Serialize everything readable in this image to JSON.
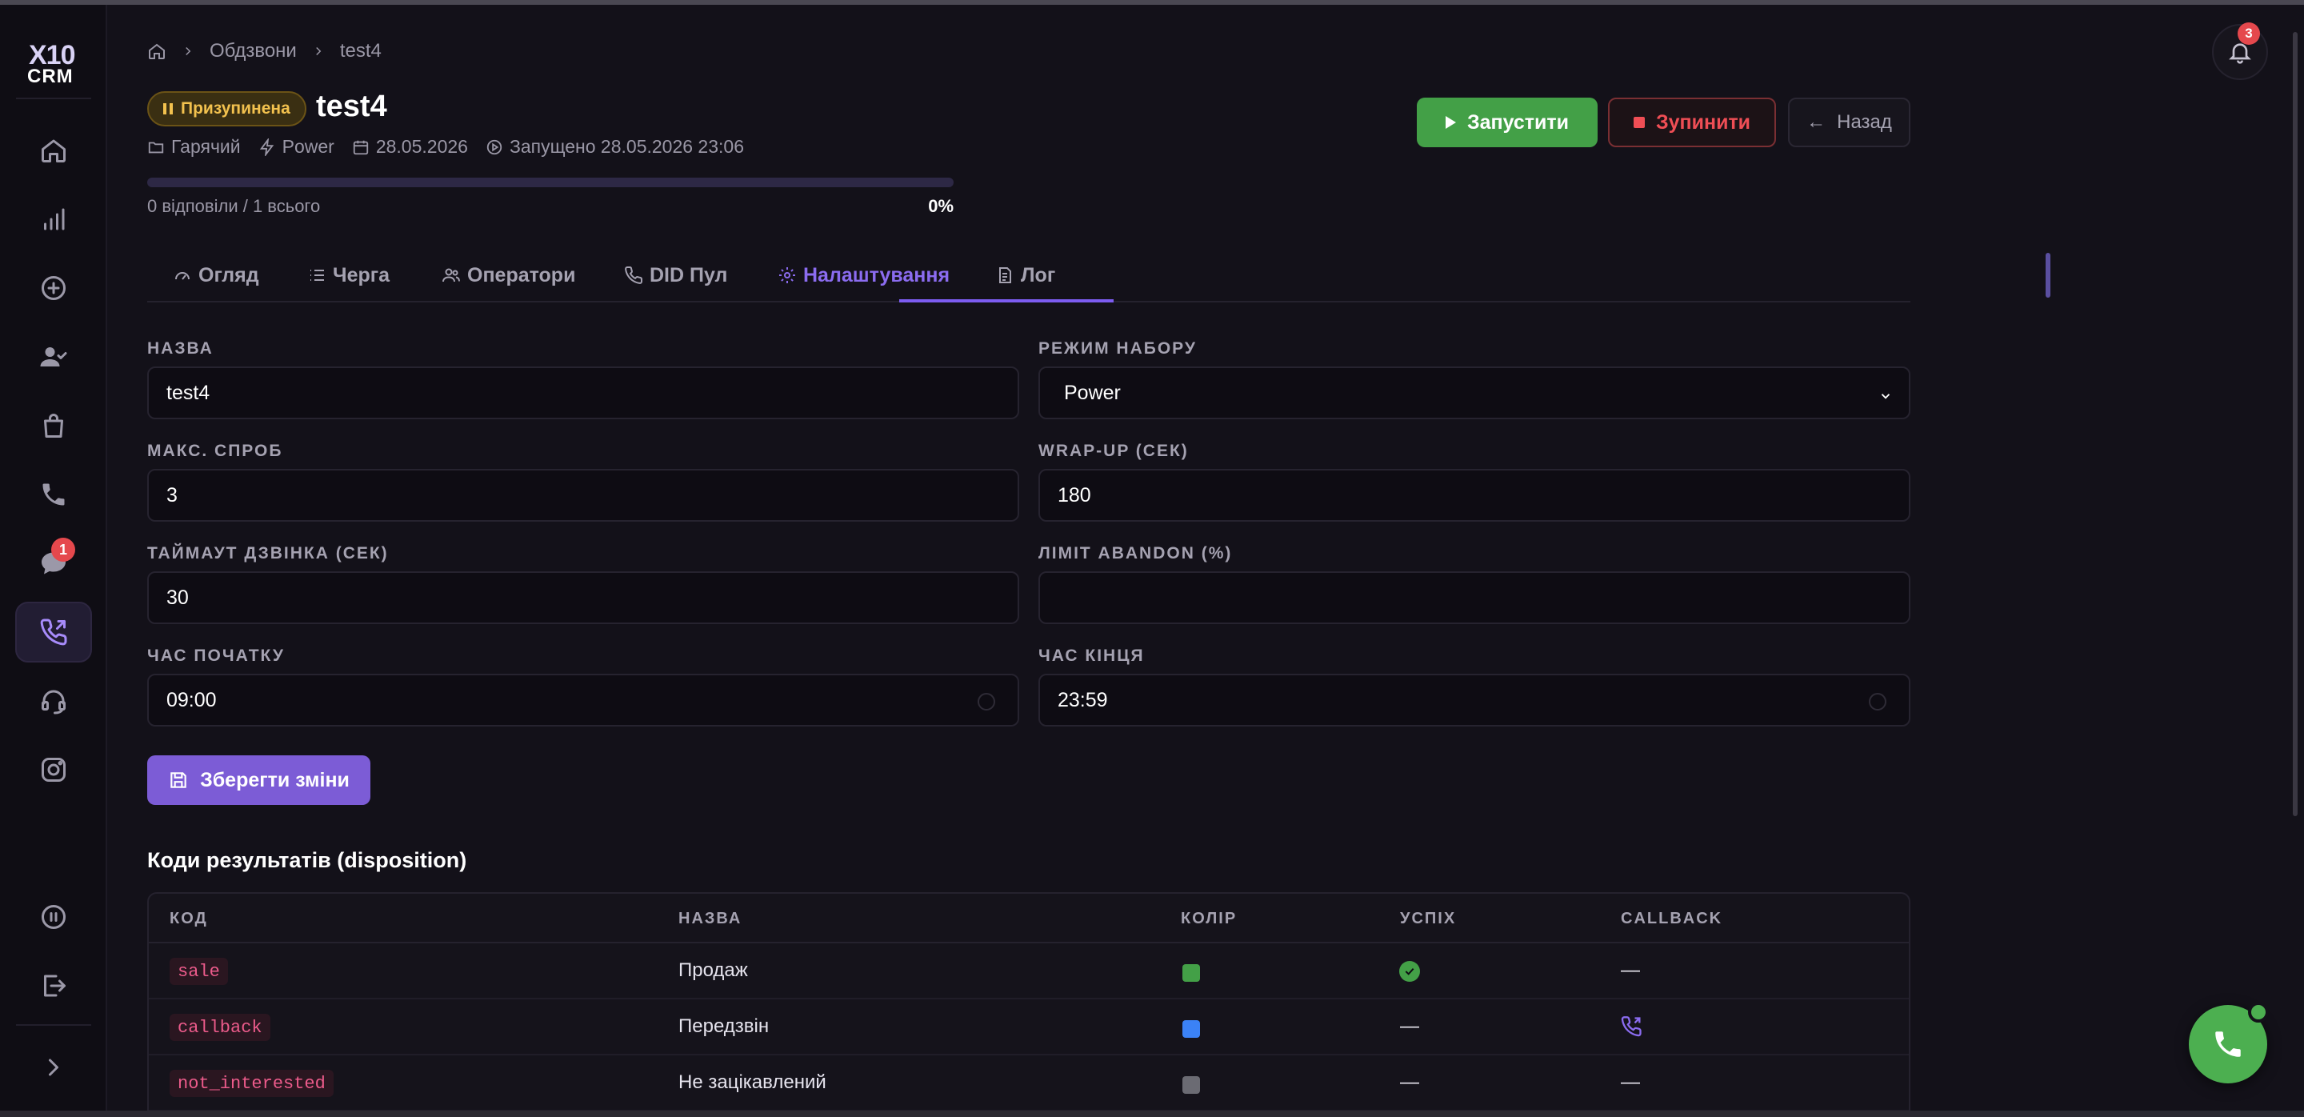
{
  "logo": {
    "top": "X10",
    "bottom": "CRM"
  },
  "sidebar": {
    "chat_badge": "1"
  },
  "notifications": {
    "count": "3"
  },
  "breadcrumb": {
    "section": "Обдзвони",
    "current": "test4"
  },
  "campaign": {
    "status": "Призупинена",
    "status_color": "#f2c14e",
    "title": "test4",
    "folder": "Гарячий",
    "mode": "Power",
    "date": "28.05.2026",
    "started": "Запущено 28.05.2026 23:06",
    "progress_label": "0 відповіли / 1 всього",
    "progress_pct": "0%",
    "progress_value": 0
  },
  "actions": {
    "start": "Запустити",
    "stop": "Зупинити",
    "back": "Назад"
  },
  "tabs": [
    "Огляд",
    "Черга",
    "Оператори",
    "DID Пул",
    "Налаштування",
    "Лог"
  ],
  "form": {
    "name_label": "НАЗВА",
    "name_value": "test4",
    "dial_mode_label": "РЕЖИМ НАБОРУ",
    "dial_mode_value": "Power",
    "max_attempts_label": "МАКС. СПРОБ",
    "max_attempts_value": "3",
    "wrapup_label": "WRAP-UP (СЕК)",
    "wrapup_value": "180",
    "timeout_label": "ТАЙМАУТ ДЗВІНКА (СЕК)",
    "timeout_value": "30",
    "abandon_label": "ЛІМІТ ABANDON (%)",
    "abandon_value": "",
    "start_time_label": "ЧАС ПОЧАТКУ",
    "start_time_value": "09:00",
    "end_time_label": "ЧАС КІНЦЯ",
    "end_time_value": "23:59",
    "save_label": "Зберегти зміни"
  },
  "dispositions": {
    "title": "Коди результатів (disposition)",
    "columns": [
      "КОД",
      "НАЗВА",
      "КОЛІР",
      "УСПІХ",
      "CALLBACK"
    ],
    "rows": [
      {
        "code": "sale",
        "name": "Продаж",
        "color": "#43a047",
        "success": "✓",
        "callback": "—"
      },
      {
        "code": "callback",
        "name": "Передзвін",
        "color": "#3b82f6",
        "success": "—",
        "callback": "phone-callback"
      },
      {
        "code": "not_interested",
        "name": "Не зацікавлений",
        "color": "#6b6b73",
        "success": "—",
        "callback": "—"
      }
    ]
  }
}
